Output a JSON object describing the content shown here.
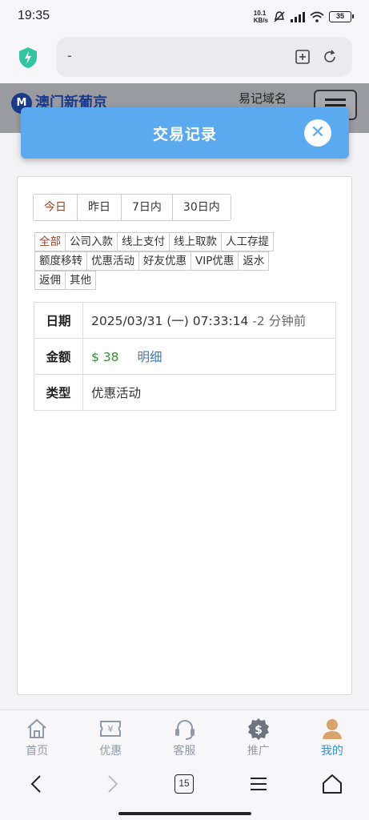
{
  "status_bar": {
    "time": "19:35",
    "net_speed_value": "10.1",
    "net_speed_unit": "KB/s",
    "battery": "35"
  },
  "browser": {
    "url": "-",
    "tab_count": "15"
  },
  "site": {
    "logo_mark": "M",
    "name": "澳门新葡京",
    "link": "易记域名"
  },
  "modal": {
    "title": "交易记录",
    "close_symbol": "✕"
  },
  "periods": [
    {
      "label": "今日",
      "active": true
    },
    {
      "label": "昨日",
      "active": false
    },
    {
      "label": "7日内",
      "active": false
    },
    {
      "label": "30日内",
      "active": false
    }
  ],
  "types": {
    "row1": [
      "全部",
      "公司入款",
      "线上支付",
      "线上取款",
      "人工存提"
    ],
    "row2": [
      "额度移转",
      "优惠活动",
      "好友优惠",
      "VIP优惠",
      "返水"
    ],
    "row3": [
      "返佣",
      "其他"
    ],
    "active": "全部"
  },
  "record": {
    "date_label": "日期",
    "date_value": "2025/03/31 (一) 07:33:14",
    "date_relative": "-2 分钟前",
    "amount_label": "金额",
    "amount_value": "$ 38",
    "amount_link": "明细",
    "type_label": "类型",
    "type_value": "优惠活动"
  },
  "bottom_nav": [
    {
      "label": "首页",
      "icon": "home-icon",
      "active": false
    },
    {
      "label": "优惠",
      "icon": "coupon-icon",
      "active": false
    },
    {
      "label": "客服",
      "icon": "headset-icon",
      "active": false
    },
    {
      "label": "推广",
      "icon": "dollar-icon",
      "active": false
    },
    {
      "label": "我的",
      "icon": "user-icon",
      "active": true
    }
  ],
  "colors": {
    "accent": "#5baaf0",
    "active_red": "#a0432a",
    "money_green": "#3a8b3a",
    "link_blue": "#3a7ab8",
    "nav_active": "#3b8fd0"
  }
}
